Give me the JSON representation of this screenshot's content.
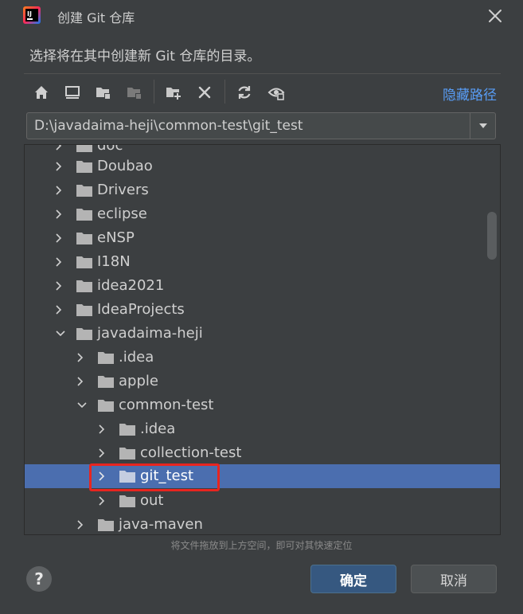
{
  "dialog": {
    "title": "创建 Git 仓库",
    "description": "选择将在其中创建新 Git 仓库的目录。",
    "hide_path_label": "隐藏路径",
    "path_value": "D:\\javadaima-heji\\common-test\\git_test",
    "drag_hint": "将文件拖放到上方空间，即可对其快速定位",
    "help_label": "?",
    "ok_label": "确定",
    "cancel_label": "取消"
  },
  "toolbar": {
    "icons": [
      "home-icon",
      "desktop-icon",
      "project-folder-icon",
      "module-folder-icon",
      "new-folder-icon",
      "delete-icon",
      "refresh-icon",
      "show-hidden-icon"
    ]
  },
  "tree": {
    "items": [
      {
        "label": "doc",
        "expanded": false
      },
      {
        "label": "Doubao",
        "expanded": false
      },
      {
        "label": "Drivers",
        "expanded": false
      },
      {
        "label": "eclipse",
        "expanded": false
      },
      {
        "label": "eNSP",
        "expanded": false
      },
      {
        "label": "I18N",
        "expanded": false
      },
      {
        "label": "idea2021",
        "expanded": false
      },
      {
        "label": "IdeaProjects",
        "expanded": false
      },
      {
        "label": "javadaima-heji",
        "expanded": true
      },
      {
        "label": ".idea",
        "expanded": false
      },
      {
        "label": "apple",
        "expanded": false
      },
      {
        "label": "common-test",
        "expanded": true
      },
      {
        "label": ".idea",
        "expanded": false
      },
      {
        "label": "collection-test",
        "expanded": false
      },
      {
        "label": "git_test",
        "expanded": false,
        "selected": true
      },
      {
        "label": "out",
        "expanded": false
      },
      {
        "label": "java-maven",
        "expanded": false
      }
    ]
  },
  "colors": {
    "background": "#3c3f41",
    "selection": "#4b6eaf",
    "link": "#589df6",
    "highlight_border": "#e8251f",
    "primary_button": "#365880"
  }
}
